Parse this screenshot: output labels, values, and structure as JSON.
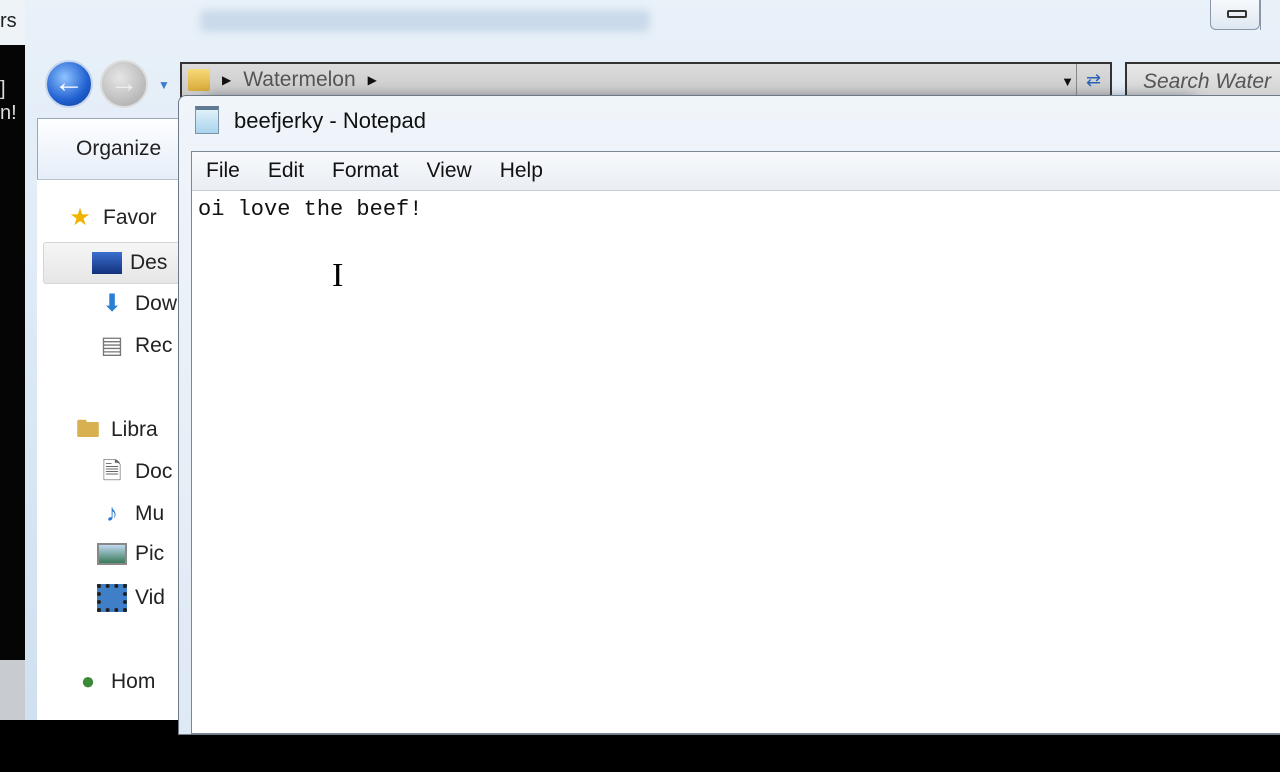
{
  "background_window": {
    "left_fragments": [
      "rs",
      "]",
      "n!"
    ],
    "address_path": "Watermelon",
    "search_placeholder": "Search Water",
    "organize_label": "Organize",
    "nav_items": [
      {
        "label": "Favor",
        "icon": "star-icon"
      },
      {
        "label": "Des",
        "icon": "desktop-icon"
      },
      {
        "label": "Dow",
        "icon": "downloads-icon"
      },
      {
        "label": "Rec",
        "icon": "recent-places-icon"
      },
      {
        "label": "Libra",
        "icon": "libraries-icon"
      },
      {
        "label": "Doc",
        "icon": "documents-icon"
      },
      {
        "label": "Mu",
        "icon": "music-icon"
      },
      {
        "label": "Pic",
        "icon": "pictures-icon"
      },
      {
        "label": "Vid",
        "icon": "videos-icon"
      },
      {
        "label": "Hom",
        "icon": "homegroup-icon"
      }
    ]
  },
  "notepad": {
    "title": "beefjerky - Notepad",
    "menu": [
      "File",
      "Edit",
      "Format",
      "View",
      "Help"
    ],
    "content": "oi love the beef!"
  }
}
